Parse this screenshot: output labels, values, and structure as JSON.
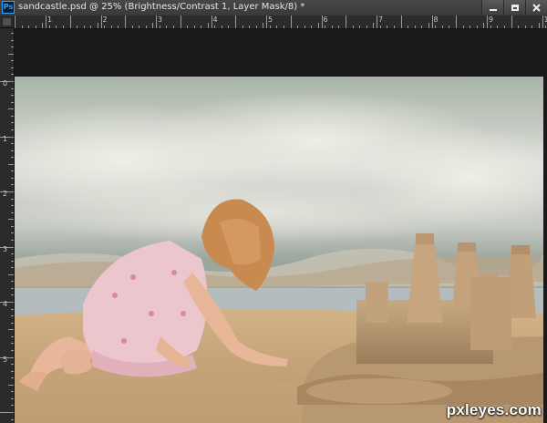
{
  "app": {
    "logo_text": "Ps",
    "document_title": "sandcastle.psd @ 25% (Brightness/Contrast 1, Layer Mask/8) *"
  },
  "window_controls": {
    "minimize": "minimize",
    "maximize": "maximize",
    "close": "close"
  },
  "rulers": {
    "horizontal_labels": [
      "1",
      "2",
      "3",
      "4",
      "5",
      "6",
      "7",
      "8",
      "9",
      "10"
    ],
    "vertical_labels": [
      "0",
      "1",
      "2",
      "3",
      "4",
      "5"
    ]
  },
  "canvas": {
    "zoom": "25%",
    "active_layer": "Brightness/Contrast 1",
    "watermark": "pxleyes.com"
  },
  "colors": {
    "titlebar": "#3f3f3f",
    "ruler": "#2b2b2b",
    "workspace": "#1a1a1a",
    "ps_accent": "#2fa3f7"
  }
}
